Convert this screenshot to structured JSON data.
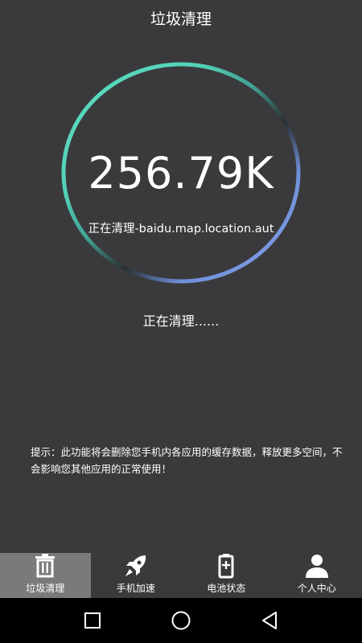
{
  "header": {
    "title": "垃圾清理"
  },
  "scan": {
    "size_value": "256.79K",
    "current_file": "正在清理-baidu.map.location.aut",
    "status": "正在清理......"
  },
  "hint": {
    "text": "提示：此功能将会删除您手机内各应用的缓存数据，释放更多空间，不会影响您其他应用的正常使用！"
  },
  "tabs": [
    {
      "label": "垃圾清理",
      "icon": "trash-icon",
      "active": true
    },
    {
      "label": "手机加速",
      "icon": "rocket-icon",
      "active": false
    },
    {
      "label": "电池状态",
      "icon": "battery-icon",
      "active": false
    },
    {
      "label": "个人中心",
      "icon": "person-icon",
      "active": false
    }
  ],
  "navigation": {
    "recent": "square-icon",
    "home": "circle-icon",
    "back": "triangle-back-icon"
  },
  "colors": {
    "background": "#3a3a3c",
    "ring_start": "#5fe0c0",
    "ring_end": "#7a9ae8",
    "active_tab": "#7a7a7a",
    "nav_bar": "#000000"
  }
}
